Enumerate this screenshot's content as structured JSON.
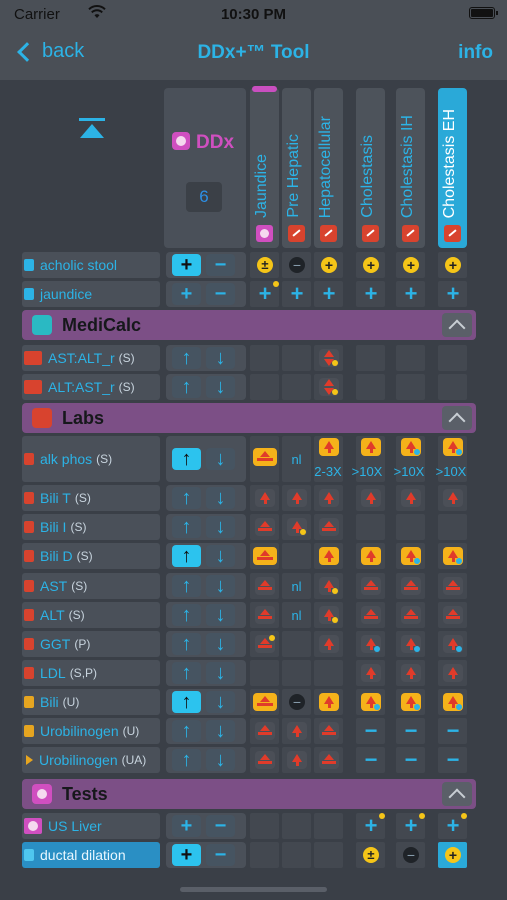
{
  "status": {
    "carrier": "Carrier",
    "time": "10:30 PM"
  },
  "nav": {
    "back": "back",
    "title": "DDx+™ Tool",
    "info": "info"
  },
  "ddx": {
    "label": "DDx",
    "count": "6"
  },
  "columns": [
    "Jaundice",
    "Pre Hepatic",
    "Hepatocellular",
    "Cholestasis",
    "Cholestasis IH",
    "Cholestasis EH"
  ],
  "findings": [
    {
      "label": "acholic stool",
      "suffix": ""
    },
    {
      "label": "jaundice",
      "suffix": ""
    }
  ],
  "sections": {
    "medicalc": "MediCalc",
    "labs": "Labs",
    "tests": "Tests"
  },
  "medicalc_rows": [
    {
      "label": "AST:ALT_r",
      "suffix": "(S)"
    },
    {
      "label": "ALT:AST_r",
      "suffix": "(S)"
    }
  ],
  "labs_rows": [
    {
      "label": "alk phos",
      "suffix": "(S)"
    },
    {
      "label": "Bili T",
      "suffix": "(S)"
    },
    {
      "label": "Bili I",
      "suffix": "(S)"
    },
    {
      "label": "Bili D",
      "suffix": "(S)"
    },
    {
      "label": "AST",
      "suffix": "(S)"
    },
    {
      "label": "ALT",
      "suffix": "(S)"
    },
    {
      "label": "GGT",
      "suffix": "(P)"
    },
    {
      "label": "LDL",
      "suffix": "(S,P)"
    },
    {
      "label": "Bili",
      "suffix": "(U)"
    },
    {
      "label": "Urobilinogen",
      "suffix": "(U)"
    },
    {
      "label": "Urobilinogen",
      "suffix": "(UA)"
    }
  ],
  "tests_rows": [
    {
      "label": "US Liver",
      "suffix": ""
    },
    {
      "label": "ductal dilation",
      "suffix": ""
    }
  ],
  "cell_text": {
    "nl": "nl",
    "alk_sub": [
      "2-3X",
      ">10X",
      ">10X",
      ">10X"
    ]
  },
  "buttons": {
    "plus": "+",
    "minus": "−",
    "up": "↑",
    "down": "↓",
    "pm": "±"
  },
  "colors": {
    "accent": "#2cb3e6",
    "section": "#7c4f86",
    "ddx": "#d04fc0",
    "highlight": "#f5c518"
  }
}
